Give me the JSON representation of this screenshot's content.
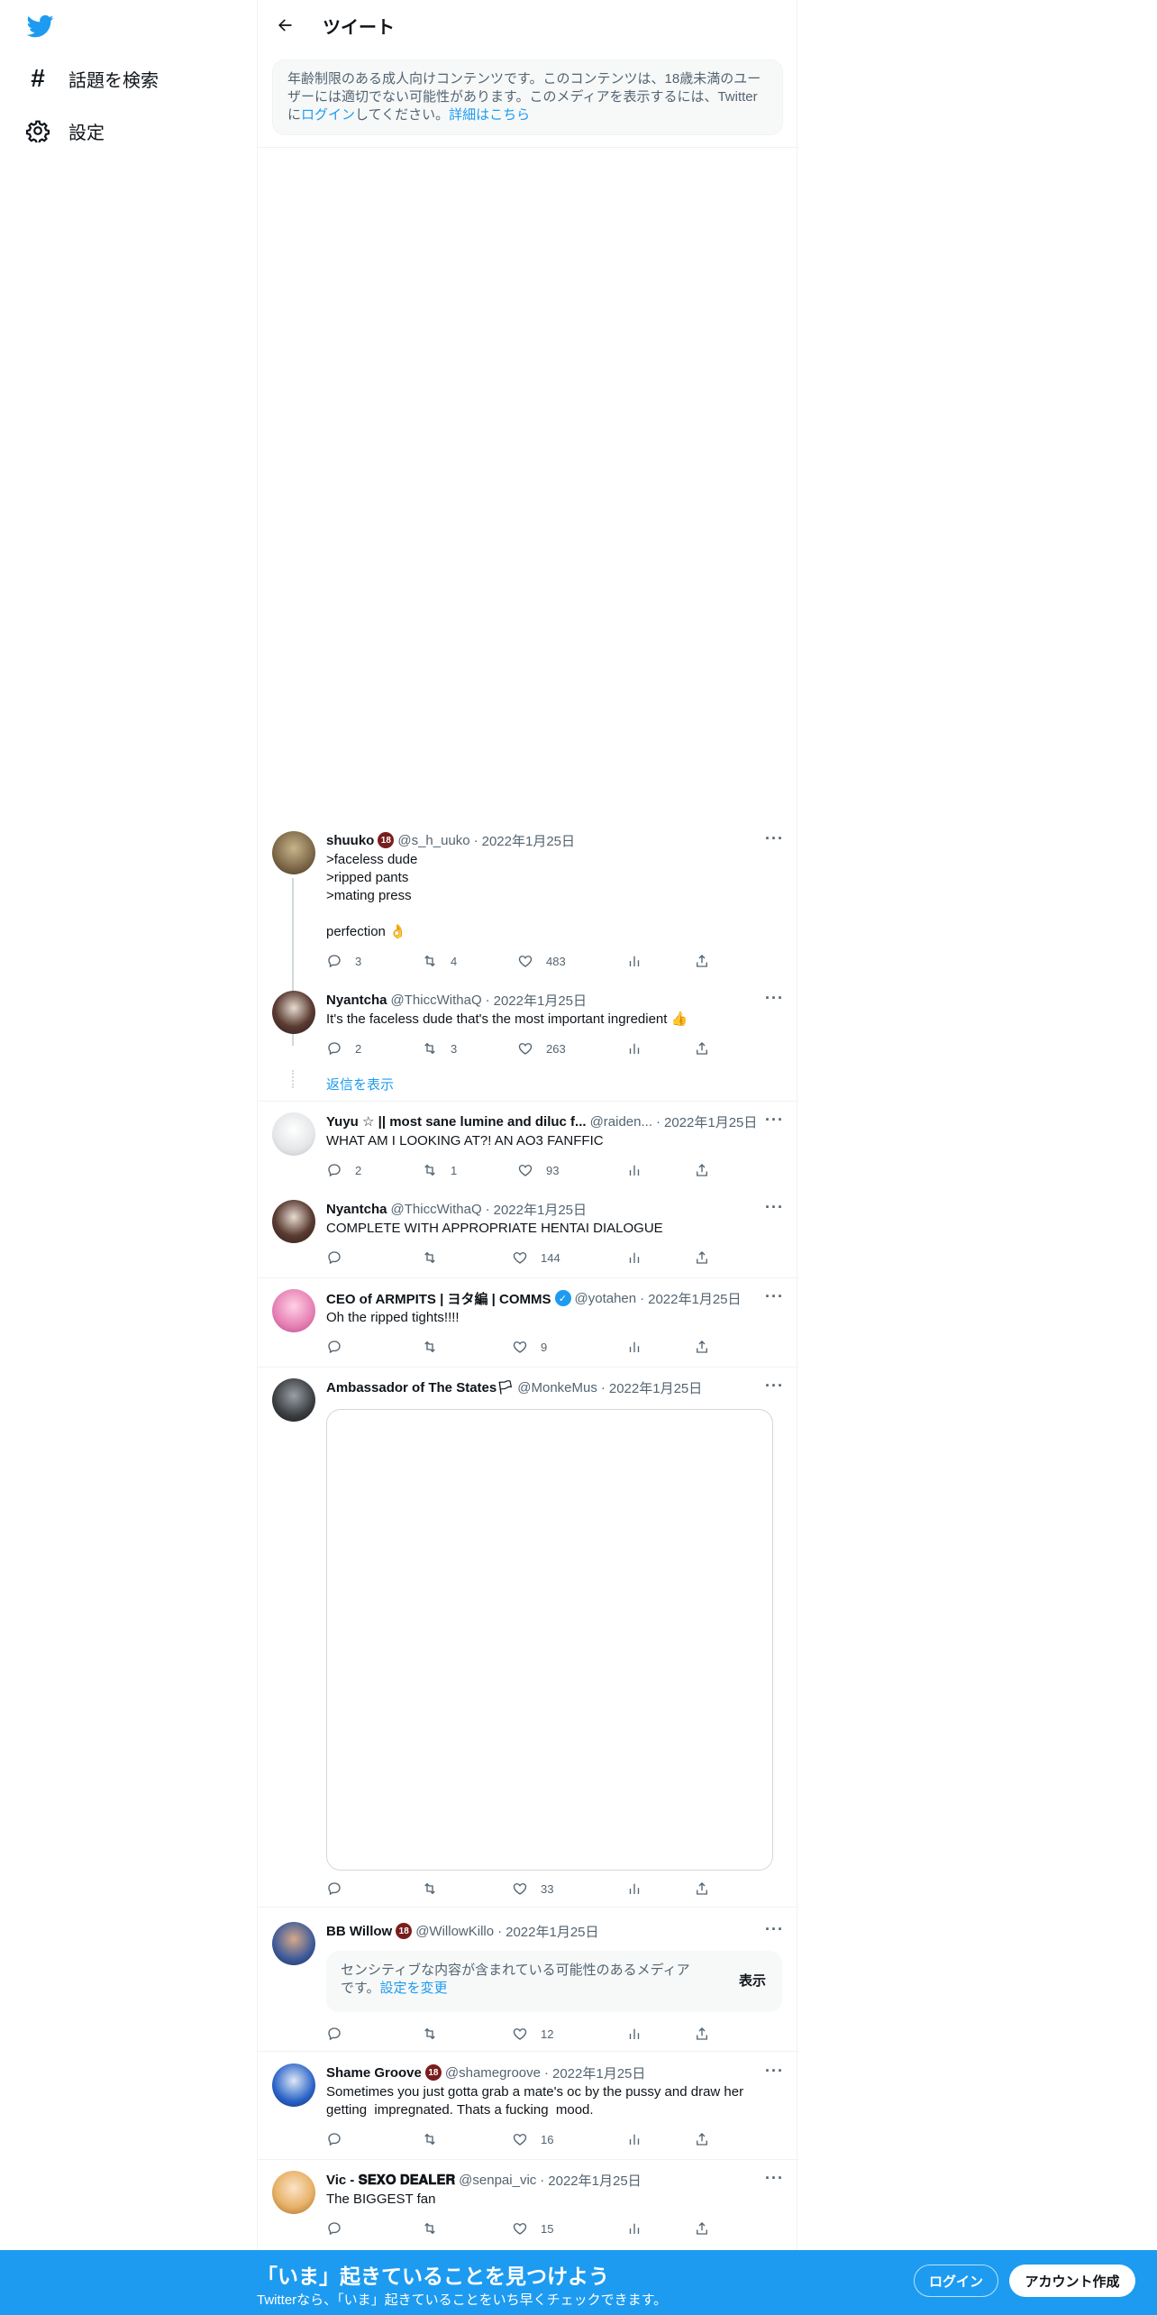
{
  "sidebar": {
    "items": [
      {
        "label": "話題を検索",
        "icon": "hashtag-icon"
      },
      {
        "label": "設定",
        "icon": "gear-icon"
      }
    ]
  },
  "header": {
    "title": "ツイート"
  },
  "age_notice": {
    "text_a": "年齢制限のある成人向けコンテンツです。このコンテンツは、18歳未満のユーザーには適切でない可能性があります。このメディアを表示するには、Twitterに",
    "login_link": "ログイン",
    "text_b": "してください。",
    "details_link": "詳細はこちら"
  },
  "tweets": [
    {
      "name": "shuuko",
      "badge": "18",
      "handle": "@s_h_uuko",
      "sep": "·",
      "date": "2022年1月25日",
      "text": ">faceless dude\n>ripped pants\n>mating press\n\nperfection 👌",
      "replies": "3",
      "retweets": "4",
      "likes": "483"
    },
    {
      "name": "Nyantcha",
      "handle": "@ThiccWithaQ",
      "sep": "·",
      "date": "2022年1月25日",
      "text": "It's the faceless dude that's the most important ingredient 👍",
      "replies": "2",
      "retweets": "3",
      "likes": "263"
    },
    {
      "name": "Yuyu ☆ || most sane lumine and diluc f...",
      "handle": "@raiden...",
      "sep": "·",
      "date": "2022年1月25日",
      "text": "WHAT AM I LOOKING AT?! AN AO3 FANFFIC",
      "replies": "2",
      "retweets": "1",
      "likes": "93"
    },
    {
      "name": "Nyantcha",
      "handle": "@ThiccWithaQ",
      "sep": "·",
      "date": "2022年1月25日",
      "text": "COMPLETE WITH APPROPRIATE HENTAI DIALOGUE",
      "replies": "",
      "retweets": "",
      "likes": "144"
    },
    {
      "name": "CEO of ARMPITS | ヨタ編 | COMMS",
      "verified": "✓",
      "handle": "@yotahen",
      "sep": "·",
      "date": "2022年1月25日",
      "text": "Oh the ripped tights!!!!",
      "replies": "",
      "retweets": "",
      "likes": "9"
    },
    {
      "name": "Ambassador of The States🏳",
      "handle": "@MonkeMus",
      "sep": "·",
      "date": "2022年1月25日",
      "text": "",
      "replies": "",
      "retweets": "",
      "likes": "33"
    },
    {
      "name": "BB Willow",
      "badge": "18",
      "handle": "@WillowKillo",
      "sep": "·",
      "date": "2022年1月25日",
      "sensitive_text": "センシティブな内容が含まれている可能性のあるメディアです。",
      "sensitive_link": "設定を変更",
      "show_label": "表示",
      "replies": "",
      "retweets": "",
      "likes": "12"
    },
    {
      "name": "Shame Groove",
      "badge": "18",
      "handle": "@shamegroove",
      "sep": "·",
      "date": "2022年1月25日",
      "text": "Sometimes you just gotta grab a mate's oc by the pussy and draw her getting  impregnated. Thats a fucking  mood.",
      "replies": "",
      "retweets": "",
      "likes": "16"
    },
    {
      "name": "Vic - 𝐒𝐄𝐗𝐎 𝐃𝐄𝐀𝐋𝐄𝐑",
      "handle": "@senpai_vic",
      "sep": "·",
      "date": "2022年1月25日",
      "text": "The BIGGEST fan",
      "replies": "",
      "retweets": "",
      "likes": "15"
    }
  ],
  "show_replies": "返信を表示",
  "more_icon": "···",
  "bottom_bar": {
    "title": "「いま」起きていることを見つけよう",
    "subtitle": "Twitterなら、「いま」起きていることをいち早くチェックできます。",
    "login": "ログイン",
    "signup": "アカウント作成"
  },
  "colors": {
    "accent": "#1d9bf0",
    "text": "#0f1419",
    "muted": "#536471"
  }
}
